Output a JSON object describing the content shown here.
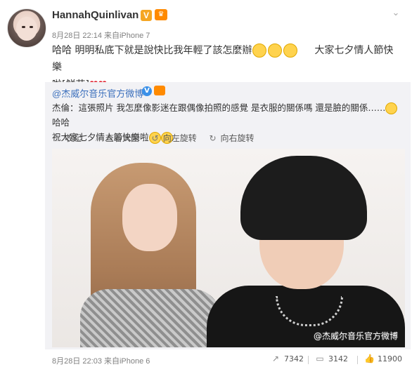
{
  "post": {
    "username": "HannahQuinlivan",
    "meta": "8月28日 22:14 来自iPhone 7",
    "text_main": "哈哈 明明私底下就是說快比我年輕了該怎麼辦",
    "text_tail": "大家七夕情人節快樂",
    "text_line2": "啦[鮮花]",
    "hearts": "❤❤"
  },
  "repost": {
    "author": "@杰威尔音乐官方微博",
    "text_line1": "杰倫：這張照片 我怎麼像影迷在跟偶像拍照的感覺 是衣服的關係嗎 還是臉的關係……",
    "text_line1_tail": "哈哈",
    "text_line2": "祝大家七夕情人節快樂啦",
    "toolbar": [
      {
        "icon": "collapse-icon",
        "label": "收起"
      },
      {
        "icon": "zoom-icon",
        "label": "查看大圖"
      },
      {
        "icon": "rotate-left-icon",
        "label": "向左旋转"
      },
      {
        "icon": "rotate-right-icon",
        "label": "向右旋转"
      }
    ],
    "watermark": "@杰威尔音乐官方微博",
    "footer_meta": "8月28日 22:03 来自iPhone 6"
  },
  "stats": {
    "reposts": "7342",
    "comments": "3142",
    "likes": "11900"
  },
  "colors": {
    "link": "#3b6fbc",
    "repost_bg": "#f2f2f5",
    "heart": "#e0202e",
    "vip_orange": "#ff8a00"
  }
}
